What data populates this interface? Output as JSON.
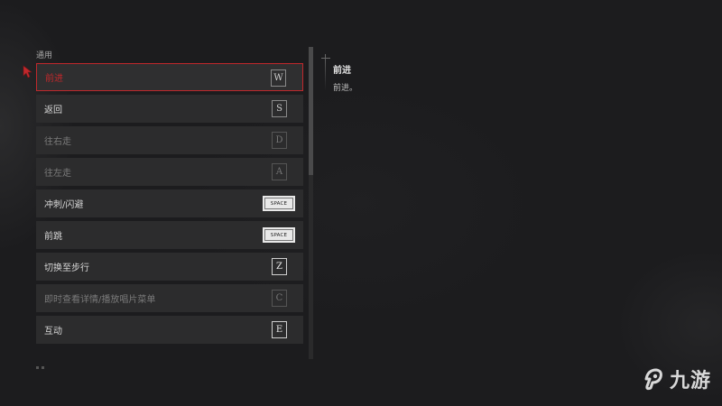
{
  "section": {
    "title": "通用"
  },
  "controls": [
    {
      "action": "前进",
      "key": "W",
      "state": "selected",
      "key_style": "plain"
    },
    {
      "action": "返回",
      "key": "S",
      "state": "normal",
      "key_style": "plain"
    },
    {
      "action": "往右走",
      "key": "D",
      "state": "dim",
      "key_style": "plain"
    },
    {
      "action": "往左走",
      "key": "A",
      "state": "dim",
      "key_style": "plain"
    },
    {
      "action": "冲刺/闪避",
      "key": "SPACE",
      "state": "normal",
      "key_style": "wide"
    },
    {
      "action": "前跳",
      "key": "SPACE",
      "state": "normal",
      "key_style": "wide"
    },
    {
      "action": "切换至步行",
      "key": "Z",
      "state": "normal",
      "key_style": "boxed"
    },
    {
      "action": "即时查看详情/播放唱片菜单",
      "key": "C",
      "state": "dim",
      "key_style": "plain"
    },
    {
      "action": "互动",
      "key": "E",
      "state": "normal",
      "key_style": "boxed"
    }
  ],
  "detail": {
    "title": "前进",
    "description": "前进。"
  },
  "watermark": {
    "text": "九游",
    "icon": "jiuyou-logo-icon"
  },
  "colors": {
    "accent": "#c0282c",
    "background": "#1c1c1e",
    "row": "#2c2c2d"
  }
}
